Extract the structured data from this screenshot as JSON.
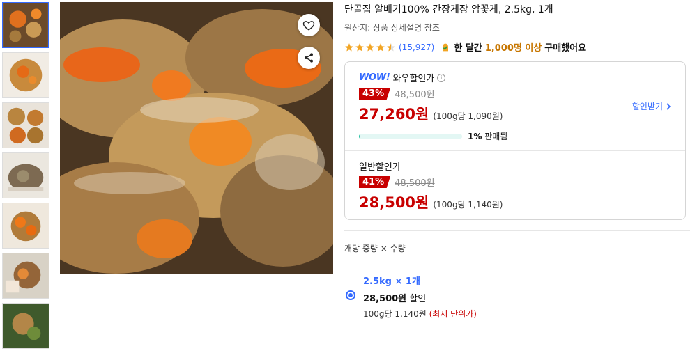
{
  "product": {
    "title": "단골집 알배기100% 간장게장 암꽃게, 2.5kg, 1개",
    "origin": "원산지: 상품 상세설명 참조",
    "rating": 4.5,
    "review_count": "(15,927)",
    "buy_stat_prefix": "한 달간",
    "buy_stat_highlight": "1,000명 이상",
    "buy_stat_suffix": "구매했어요"
  },
  "wow": {
    "logo": "WOW!",
    "label": "와우할인가",
    "percent": "43%",
    "original": "48,500원",
    "price": "27,260원",
    "unit_price": "(100g당 1,090원)",
    "coupon_label": "할인받기",
    "sold_percent_value": 1,
    "sold_percent": "1%",
    "sold_text": "판매됨"
  },
  "normal": {
    "label": "일반할인가",
    "percent": "41%",
    "original": "48,500원",
    "price": "28,500원",
    "unit_price": "(100g당 1,140원)"
  },
  "options": {
    "title": "개당 중량 × 수량",
    "items": [
      {
        "name": "2.5kg × 1개",
        "price": "28,500원",
        "price_suffix": "할인",
        "unit": "100g당 1,140원",
        "unit_note": "(최저 단위가)",
        "selected": true
      }
    ]
  },
  "colors": {
    "accent": "#346aff",
    "sale": "#c80000",
    "highlight": "#c77600",
    "progress": "#22bfa0"
  },
  "icons": [
    "heart-icon",
    "share-icon",
    "info-icon",
    "chevron-right-icon",
    "star-icon",
    "check-badge-icon"
  ]
}
